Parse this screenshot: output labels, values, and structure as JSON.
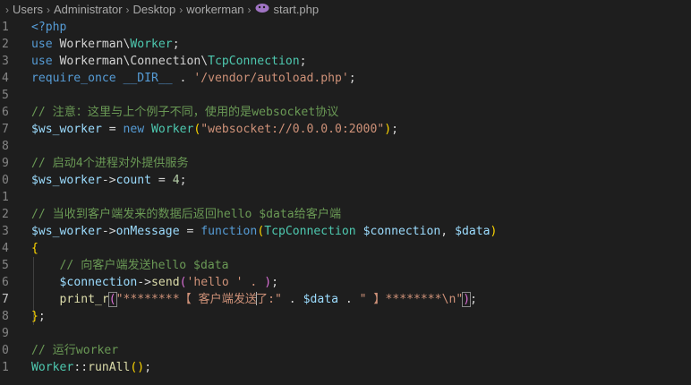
{
  "breadcrumb": {
    "items": [
      "Users",
      "Administrator",
      "Desktop",
      "workerman"
    ],
    "file": "start.php",
    "separator": "›"
  },
  "lines": [
    {
      "num": "1",
      "tokens": [
        [
          "<?php",
          "t-tag"
        ]
      ]
    },
    {
      "num": "2",
      "tokens": [
        [
          "use ",
          "t-kw"
        ],
        [
          "Workerman",
          "t-op"
        ],
        [
          "\\",
          "t-op"
        ],
        [
          "Worker",
          "t-cls"
        ],
        [
          ";",
          "t-op"
        ]
      ]
    },
    {
      "num": "3",
      "tokens": [
        [
          "use ",
          "t-kw"
        ],
        [
          "Workerman",
          "t-op"
        ],
        [
          "\\",
          "t-op"
        ],
        [
          "Connection",
          "t-op"
        ],
        [
          "\\",
          "t-op"
        ],
        [
          "TcpConnection",
          "t-cls"
        ],
        [
          ";",
          "t-op"
        ]
      ]
    },
    {
      "num": "4",
      "tokens": [
        [
          "require_once ",
          "t-kw"
        ],
        [
          "__DIR__",
          "t-kw"
        ],
        [
          " . ",
          "t-op"
        ],
        [
          "'/vendor/autoload.php'",
          "t-str"
        ],
        [
          ";",
          "t-op"
        ]
      ]
    },
    {
      "num": "5",
      "tokens": []
    },
    {
      "num": "6",
      "tokens": [
        [
          "// 注意：这里与上个例子不同，使用的是websocket协议",
          "t-com"
        ]
      ]
    },
    {
      "num": "7",
      "tokens": [
        [
          "$ws_worker",
          "t-var"
        ],
        [
          " = ",
          "t-op"
        ],
        [
          "new ",
          "t-kw"
        ],
        [
          "Worker",
          "t-cls"
        ],
        [
          "(",
          "t-b1"
        ],
        [
          "\"websocket://0.0.0.0:2000\"",
          "t-str"
        ],
        [
          ")",
          "t-b1"
        ],
        [
          ";",
          "t-op"
        ]
      ]
    },
    {
      "num": "8",
      "tokens": []
    },
    {
      "num": "9",
      "tokens": [
        [
          "// 启动4个进程对外提供服务",
          "t-com"
        ]
      ]
    },
    {
      "num": "0",
      "tokens": [
        [
          "$ws_worker",
          "t-var"
        ],
        [
          "->",
          "t-op"
        ],
        [
          "count",
          "t-var"
        ],
        [
          " = ",
          "t-op"
        ],
        [
          "4",
          "t-num"
        ],
        [
          ";",
          "t-op"
        ]
      ]
    },
    {
      "num": "1",
      "tokens": []
    },
    {
      "num": "2",
      "tokens": [
        [
          "// 当收到客户端发来的数据后返回hello $data给客户端",
          "t-com"
        ]
      ]
    },
    {
      "num": "3",
      "tokens": [
        [
          "$ws_worker",
          "t-var"
        ],
        [
          "->",
          "t-op"
        ],
        [
          "onMessage",
          "t-var"
        ],
        [
          " = ",
          "t-op"
        ],
        [
          "function",
          "t-kw"
        ],
        [
          "(",
          "t-b1"
        ],
        [
          "TcpConnection ",
          "t-cls"
        ],
        [
          "$connection",
          "t-var"
        ],
        [
          ", ",
          "t-op"
        ],
        [
          "$data",
          "t-var"
        ],
        [
          ")",
          "t-b1"
        ]
      ]
    },
    {
      "num": "4",
      "tokens": [
        [
          "{",
          "t-b1"
        ]
      ]
    },
    {
      "num": "5",
      "tokens": [
        [
          "    ",
          "t-op"
        ],
        [
          "// 向客户端发送hello $data",
          "t-com"
        ]
      ]
    },
    {
      "num": "6",
      "tokens": [
        [
          "    ",
          "t-op"
        ],
        [
          "$connection",
          "t-var"
        ],
        [
          "->",
          "t-op"
        ],
        [
          "send",
          "t-fn"
        ],
        [
          "(",
          "t-b2"
        ],
        [
          "'hello ' . ",
          "t-str"
        ],
        [
          ")",
          "t-b2"
        ],
        [
          ";",
          "t-op"
        ]
      ]
    },
    {
      "num": "7",
      "active": true,
      "tokens": [
        [
          "    ",
          "t-op"
        ],
        [
          "print_r",
          "t-fn"
        ],
        [
          "(",
          "t-b2 bmatch"
        ],
        [
          "\"********【 客户端发送",
          "t-str"
        ],
        [
          "|",
          "cursor"
        ],
        [
          "了:\"",
          "t-str"
        ],
        [
          " . ",
          "t-op"
        ],
        [
          "$data",
          "t-var"
        ],
        [
          " . ",
          "t-op"
        ],
        [
          "\" 】********\\n\"",
          "t-str"
        ],
        [
          ")",
          "t-b2 bmatch"
        ],
        [
          ";",
          "t-op"
        ]
      ]
    },
    {
      "num": "8",
      "tokens": [
        [
          "}",
          "t-b1"
        ],
        [
          ";",
          "t-op"
        ]
      ]
    },
    {
      "num": "9",
      "tokens": []
    },
    {
      "num": "0",
      "tokens": [
        [
          "// 运行worker",
          "t-com"
        ]
      ]
    },
    {
      "num": "1",
      "tokens": [
        [
          "Worker",
          "t-cls"
        ],
        [
          "::",
          "t-op"
        ],
        [
          "runAll",
          "t-fn"
        ],
        [
          "(",
          "t-b1"
        ],
        [
          ")",
          "t-b1"
        ],
        [
          ";",
          "t-op"
        ]
      ]
    }
  ]
}
